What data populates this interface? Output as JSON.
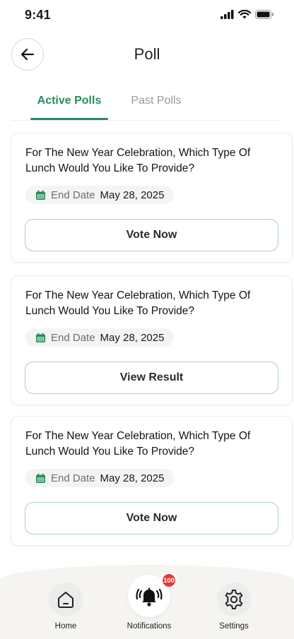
{
  "status_bar": {
    "time": "9:41"
  },
  "header": {
    "title": "Poll",
    "back_icon": "arrow-left-icon"
  },
  "tabs": [
    {
      "label": "Active Polls",
      "active": true
    },
    {
      "label": "Past Polls",
      "active": false
    }
  ],
  "polls": [
    {
      "question": "For The New Year Celebration, Which Type Of Lunch Would You Like To Provide?",
      "date_label": "End Date",
      "date_value": "May 28, 2025",
      "action_label": "Vote Now"
    },
    {
      "question": "For The New Year Celebration, Which Type Of Lunch Would You Like To Provide?",
      "date_label": "End Date",
      "date_value": "May 28, 2025",
      "action_label": "View Result"
    },
    {
      "question": "For The New Year Celebration, Which Type Of Lunch Would You Like To Provide?",
      "date_label": "End Date",
      "date_value": "May 28, 2025",
      "action_label": "Vote Now"
    }
  ],
  "bottom_nav": {
    "items": [
      {
        "label": "Home",
        "icon": "home-icon"
      },
      {
        "label": "Notifications",
        "icon": "bell-icon",
        "active": true,
        "badge": "100"
      },
      {
        "label": "Settings",
        "icon": "gear-icon"
      }
    ]
  },
  "colors": {
    "accent": "#2a8a5c",
    "badge": "#e53935",
    "nav_background": "#f6f4f1"
  }
}
